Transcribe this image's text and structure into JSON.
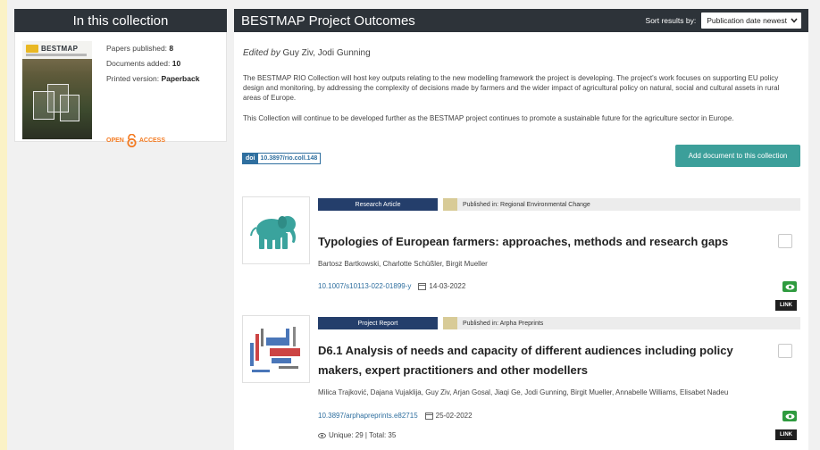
{
  "sidebar": {
    "title": "In this collection",
    "cover_logo": "BESTMAP",
    "stats": [
      {
        "label": "Papers published:",
        "value": "8"
      },
      {
        "label": "Documents added:",
        "value": "10"
      },
      {
        "label": "Printed version:",
        "value": "Paperback"
      }
    ],
    "open_access": {
      "left": "OPEN",
      "right": "ACCESS"
    }
  },
  "header": {
    "title": "BESTMAP Project Outcomes",
    "sort_label": "Sort results by:",
    "sort_value": "Publication date newest"
  },
  "collection": {
    "edited_prefix": "Edited by",
    "editors": "Guy Ziv, Jodi Gunning",
    "description_1": "The BESTMAP RIO Collection will host key outputs relating to the new modelling framework the project is developing. The project's work focuses on supporting EU policy design and monitoring, by addressing the complexity of decisions made by farmers and the wider impact of agricultural policy on natural, social and cultural assets in rural areas of Europe.",
    "description_2": "This Collection will continue to be developed further as the BESTMAP project continues to promote a sustainable future for the agriculture sector in Europe.",
    "doi_key": "doi",
    "doi_value": "10.3897/rio.coll.148",
    "add_button": "Add document to this collection"
  },
  "articles": [
    {
      "type": "Research Article",
      "published_in": "Published in: Regional Environmental Change",
      "title": "Typologies of European farmers: approaches, methods and research gaps",
      "authors": "Bartosz Bartkowski, Charlotte Schüßler, Birgit Mueller",
      "doi": "10.1007/s10113-022-01899-y",
      "date": "14-03-2022",
      "link": "LINK"
    },
    {
      "type": "Project Report",
      "published_in": "Published in: Arpha Preprints",
      "title": "D6.1 Analysis of needs and capacity of different audiences including policy makers, expert practitioners and other modellers",
      "authors": "Milica Trajković, Dajana Vujaklija, Guy Ziv, Arjan Gosal, Jiaqi Ge, Jodi Gunning, Birgit Mueller, Annabelle Williams, Elisabet Nadeu",
      "doi": "10.3897/arphapreprints.e82715",
      "date": "25-02-2022",
      "stats": "Unique: 29 | Total: 35",
      "link": "LINK"
    }
  ],
  "colors": {
    "header_bg": "#2d3339",
    "accent_teal": "#3c9f9a",
    "tag_navy": "#243e6b",
    "doi_blue": "#2f6f9f",
    "open_access": "#f37a21",
    "elephant": "#3aa39d",
    "view_green": "#2f9b3f"
  },
  "icons": {
    "sort": "chevron-down-icon",
    "date": "calendar-icon",
    "view": "eye-icon",
    "thumb_1": "elephant-icon"
  }
}
